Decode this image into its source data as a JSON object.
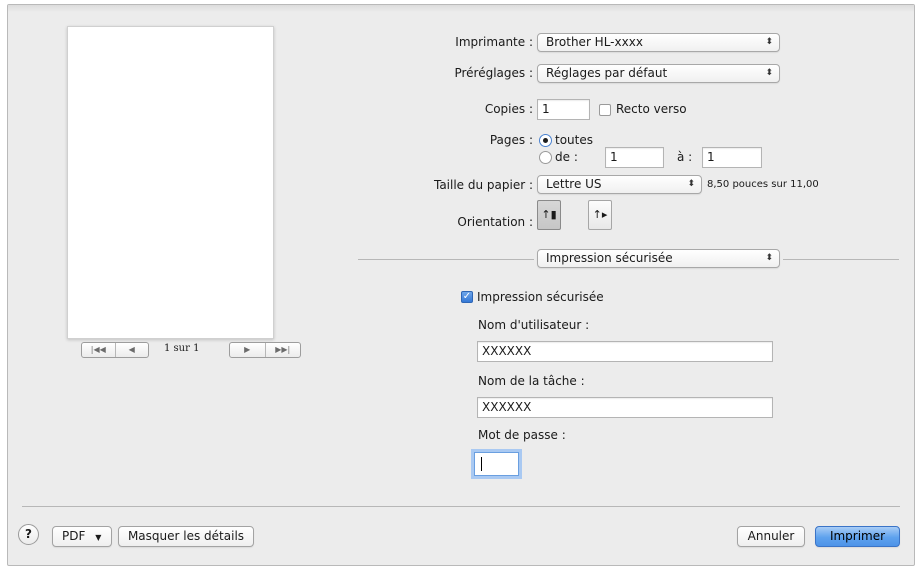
{
  "preview": {
    "page_indicator": "1 sur 1",
    "nav_first": "|◀◀",
    "nav_prev": "◀",
    "nav_next": "▶",
    "nav_last": "▶▶|"
  },
  "printer": {
    "label": "Imprimante :",
    "value": "Brother HL-xxxx"
  },
  "presets": {
    "label": "Préréglages :",
    "value": "Réglages par défaut"
  },
  "copies": {
    "label": "Copies :",
    "value": "1",
    "duplex_label": "Recto verso",
    "duplex_checked": false
  },
  "pages": {
    "label": "Pages :",
    "all_label": "toutes",
    "from_label": "de :",
    "from_value": "1",
    "to_label": "à :",
    "to_value": "1",
    "selected": "toutes"
  },
  "paper_size": {
    "label": "Taille du papier :",
    "value": "Lettre US",
    "dimensions": "8,50 pouces sur 11,00"
  },
  "orientation": {
    "label": "Orientation :",
    "selected": "portrait"
  },
  "section_popup": {
    "value": "Impression sécurisée"
  },
  "secure_print": {
    "checkbox_label": "Impression sécurisée",
    "checked": true,
    "username_label": "Nom d'utilisateur :",
    "username_value": "XXXXXX",
    "job_name_label": "Nom de la tâche :",
    "job_name_value": "XXXXXX",
    "password_label": "Mot de passe :",
    "password_value": ""
  },
  "footer": {
    "help_glyph": "?",
    "pdf_label": "PDF",
    "details_label": "Masquer les détails",
    "cancel_label": "Annuler",
    "print_label": "Imprimer"
  },
  "colors": {
    "accent": "#4d93e8",
    "dialog_bg": "#ececec"
  }
}
